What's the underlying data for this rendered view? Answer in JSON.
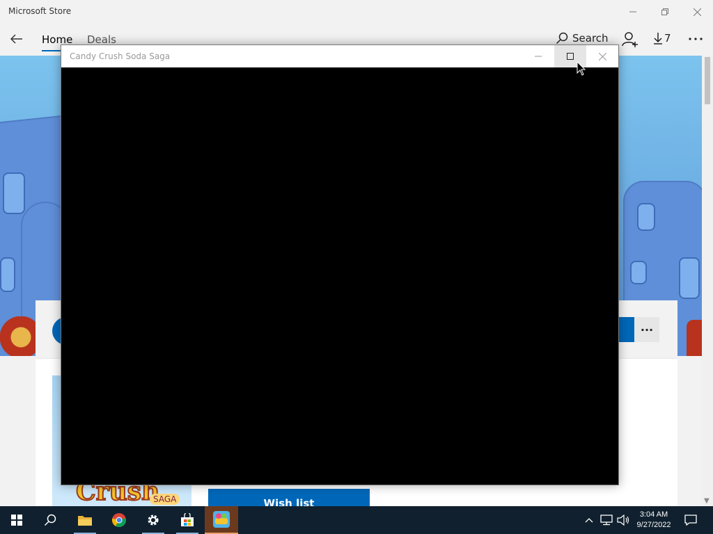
{
  "store_window": {
    "title": "Microsoft Store",
    "nav": {
      "tabs": [
        {
          "label": "Home",
          "active": true
        },
        {
          "label": "Deals",
          "active": false
        }
      ],
      "search_label": "Search",
      "downloads_count": "7"
    },
    "product": {
      "wishlist_label": "Wish list",
      "logo_text": "Crush",
      "logo_badge": "SAGA",
      "more_label": "···"
    }
  },
  "game_window": {
    "title": "Candy Crush Soda Saga"
  },
  "taskbar": {
    "time": "3:04 AM",
    "date": "9/27/2022"
  },
  "colors": {
    "accent": "#0067b8",
    "taskbar": "#10202e",
    "game_content": "#000000"
  },
  "icons": [
    "back-arrow-icon",
    "search-icon",
    "account-icon",
    "download-icon",
    "more-icon",
    "minimize-icon",
    "maximize-icon",
    "restore-icon",
    "close-icon",
    "windows-start-icon",
    "file-explorer-icon",
    "chrome-icon",
    "settings-gear-icon",
    "store-bag-icon",
    "candy-crush-icon",
    "chevron-up-icon",
    "network-icon",
    "volume-icon",
    "notification-icon"
  ]
}
